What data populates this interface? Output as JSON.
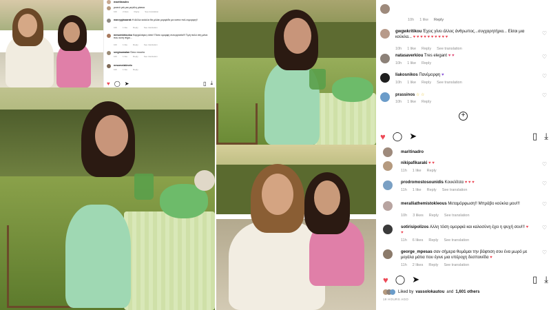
{
  "tl_panel": {
    "comments": [
      {
        "user": "maritinadro",
        "text": "",
        "meta": []
      },
      {
        "user": "",
        "text": "ρυσεό γιά μια μεγάλη μάσκα",
        "meta": [
          "10h",
          "2 likes",
          "Reply",
          "See translation"
        ]
      },
      {
        "user": "marvyginoarak",
        "text": "Η Αέλλα κούκλα θα μιλάει μορφάδε μα κοπια πολ ευμορφη!!",
        "meta": [
          "10h",
          "1 like",
          "Reply",
          "See translation"
        ]
      },
      {
        "user": "mesombrioulou",
        "text": "Καρχαλιάρες είστε! Πόσο ομορφη συνεργασία!!! Τιμή πολύ στη μάνα που αυτή πήρε...",
        "meta": [
          "10h",
          "1 like",
          "Reply",
          "See translation"
        ]
      },
      {
        "user": "sergioumalan",
        "text": "Όσοι ντουέτο",
        "meta": [
          "10h",
          "1 like",
          "Reply",
          "See translation"
        ]
      },
      {
        "user": "nesomeizkinelo",
        "text": "",
        "meta": [
          "10h",
          "1 like",
          "Reply"
        ]
      }
    ]
  },
  "tr_panel": {
    "header": {
      "user": "",
      "meta": [
        "10h",
        "1 like",
        "Reply"
      ]
    },
    "comments": [
      {
        "user": "gwgwkritikou",
        "text": "Έχεις γίνει άλλος άνθρωπος...συγχαρητήρια... Είσαι μια κούκλα...",
        "hearts": "♥ ♥ ♥ ♥ ♥ ♥ ♥ ♥ ♥ ♥",
        "meta": [
          "10h",
          "1 like",
          "Reply",
          "See translation"
        ]
      },
      {
        "user": "natasaverkiou",
        "text": "Tres elegant",
        "hearts": "♥ ♥",
        "meta": [
          "10h",
          "1 like",
          "Reply"
        ]
      },
      {
        "user": "liakosnikos",
        "text": "Πανέμορφη",
        "hearts": "♥",
        "meta": [
          "10h",
          "1 like",
          "Reply",
          "See translation"
        ]
      },
      {
        "user": "prassinos",
        "text": "",
        "hearts": "☆ ☆",
        "meta": [
          "10h",
          "1 like",
          "Reply"
        ]
      }
    ],
    "plus": "+"
  },
  "br_panel": {
    "header": {
      "user": "maritinadro"
    },
    "comments": [
      {
        "user": "nikipafikaraki",
        "text": "",
        "hearts": "♥ ♥",
        "meta": [
          "11h",
          "1 like",
          "Reply"
        ]
      },
      {
        "user": "prodromostosounidis",
        "text": "Κουκλίτσα",
        "hearts": "♥ ♥ ♥",
        "meta": [
          "11h",
          "1 like",
          "Reply",
          "See translation"
        ]
      },
      {
        "user": "meralliathemistokleous",
        "text": "Μεταμόρφωση!! Μπράβο κούκλα μου!!!",
        "hearts": "",
        "meta": [
          "10h",
          "3 likes",
          "Reply",
          "See translation"
        ]
      },
      {
        "user": "sotirisipolizos",
        "text": "Αλλη τόση ομορφιά και καλοσύνη έχει η ψυχή σου!!!",
        "hearts": "♥ ♥",
        "meta": [
          "11h",
          "6 likes",
          "Reply",
          "See translation"
        ]
      },
      {
        "user": "george_mpesas",
        "text": "σαν σήμερα θυμάμαι την βάφτιση σου ένα μωρό με μεγάλα μάτια που έγινε μια υπέροχη δεσποινίδα",
        "hearts": "♥",
        "meta": [
          "11h",
          "2 likes",
          "Reply",
          "See translation"
        ]
      }
    ],
    "likes": {
      "prefix": "Liked by",
      "user": "vassolokautou",
      "middle": "and",
      "count": "1,601 others"
    },
    "time": "19 HOURS AGO"
  },
  "icons": [
    "heart-icon",
    "comment-icon",
    "share-icon",
    "bookmark-icon",
    "download-icon"
  ],
  "colors": {
    "accent_red": "#ed4956",
    "meta_grey": "#8e8e8e",
    "purple": "#8a55d8"
  }
}
